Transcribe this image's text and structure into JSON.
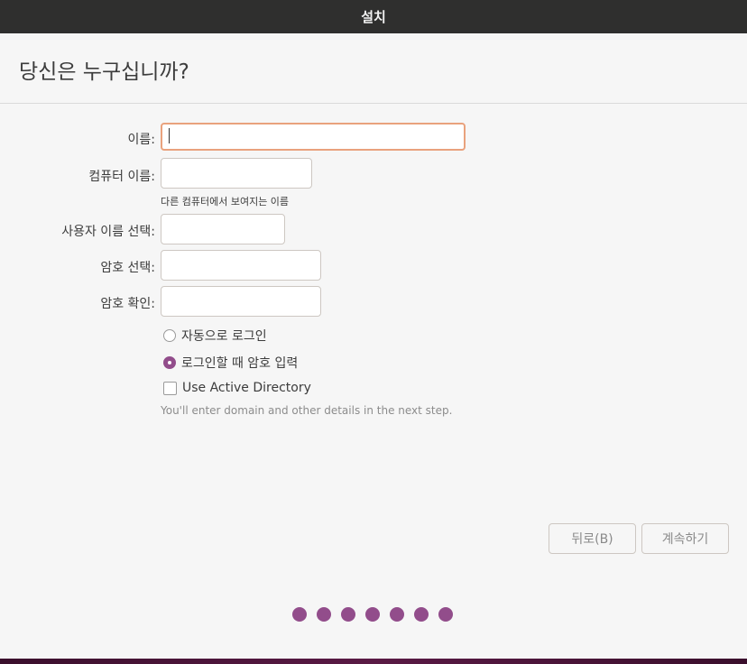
{
  "window": {
    "title": "설치"
  },
  "page": {
    "heading": "당신은 누구십니까?"
  },
  "form": {
    "name_label": "이름:",
    "name_value": "",
    "computer_label": "컴퓨터 이름:",
    "computer_value": "",
    "computer_hint": "다른 컴퓨터에서 보여지는 이름",
    "username_label": "사용자 이름 선택:",
    "username_value": "",
    "password_label": "암호 선택:",
    "password_value": "",
    "confirm_label": "암호 확인:",
    "confirm_value": ""
  },
  "login_options": {
    "auto_login_label": "자동으로 로그인",
    "auto_login_selected": false,
    "require_password_label": "로그인할 때 암호 입력",
    "require_password_selected": true
  },
  "active_directory": {
    "label": "Use Active Directory",
    "checked": false,
    "note": "You'll enter domain and other details in the next step."
  },
  "buttons": {
    "back_label": "뒤로(B)",
    "continue_label": "계속하기"
  },
  "progress": {
    "total_steps": 7
  },
  "colors": {
    "accent": "#924d8b",
    "focus": "#e9a27d",
    "titlebar": "#2f2f2e"
  }
}
